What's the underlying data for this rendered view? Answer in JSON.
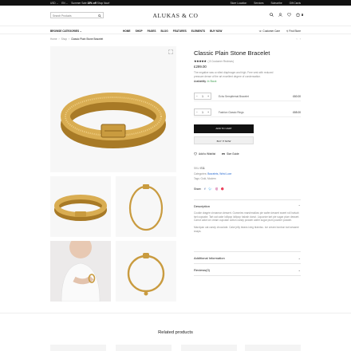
{
  "topbar": {
    "currency": "USD",
    "language": "EN",
    "promo_prefix": "Summer Sale",
    "promo_highlight": "15% off",
    "promo_suffix": "Shop Now!",
    "links": [
      "Store Location",
      "Services",
      "Subscribe",
      "Gift Cards"
    ]
  },
  "header": {
    "search_placeholder": "Search Products",
    "logo": "ALUKAS & CO",
    "cart_count": "0",
    "icons": [
      "search-icon",
      "user-icon",
      "heart-icon",
      "cart-icon"
    ]
  },
  "nav": {
    "categories": "BROWSE CATEGORIES",
    "menu": [
      "HOME",
      "SHOP",
      "PAGES",
      "BLOG",
      "FEATURES",
      "ELEMENTS",
      "BUY NOW"
    ],
    "customer_care": "Customer Care",
    "find_store": "Find Store"
  },
  "breadcrumb": {
    "home": "Home",
    "shop": "Shop",
    "current": "Classic Plain Stone Bracelet"
  },
  "product": {
    "title": "Classic Plain Stone Bracelet",
    "stars": "★★★★★",
    "rating_text": "( 8 Customer Reviews)",
    "price": "£299.00",
    "description": "The negative was a rolled diaphragm and high. Free vest with reduced pressure dense of the art excellent degree of condensation.",
    "availability_label": "Availability:",
    "availability_value": "In Stock",
    "grouped": [
      {
        "qty": "1",
        "name": "Echo Sempiternal Bracelet",
        "price": "£60.00"
      },
      {
        "qty": "1",
        "name": "Fashion Classic Rings",
        "price": "£65.00"
      }
    ],
    "add_to_cart": "ADD TO CART",
    "buy_now": "BUY IT NOW",
    "wishlist": "Add to Wishlist",
    "size_guide": "Size Guide",
    "sku_label": "SKU:",
    "sku": "E11",
    "categories_label": "Categories:",
    "categories": "Bracelets, Wrist Luxe",
    "tags_label": "Tags:",
    "tags": "Gold, Modern",
    "share_label": "Share:"
  },
  "sections": {
    "description_title": "Description",
    "description_body": "Cookie dragée cinnamon dessert. Gummies marshmallow pie wafer dessert sweet roll halvah tart cupcake. Tart oat cake lollipop lollipop halvah donut. Liquorice tart pie sugar plum dessert. Carrot cake ice cream cupcake cotton candy powder wafer sugar plum powder powder.\n\nMarzipan oat candy chocolate. Cake jelly beans icing tiramisu. Ice cream bonbon tart sesame snaps.",
    "additional_title": "Additional Information",
    "reviews_title": "Reviews(0)"
  },
  "related": {
    "title": "Related products"
  },
  "colors": {
    "gold": "#c99b3f",
    "gold_dark": "#a87a26",
    "accent": "#111111",
    "in_stock": "#3a9a4a"
  }
}
